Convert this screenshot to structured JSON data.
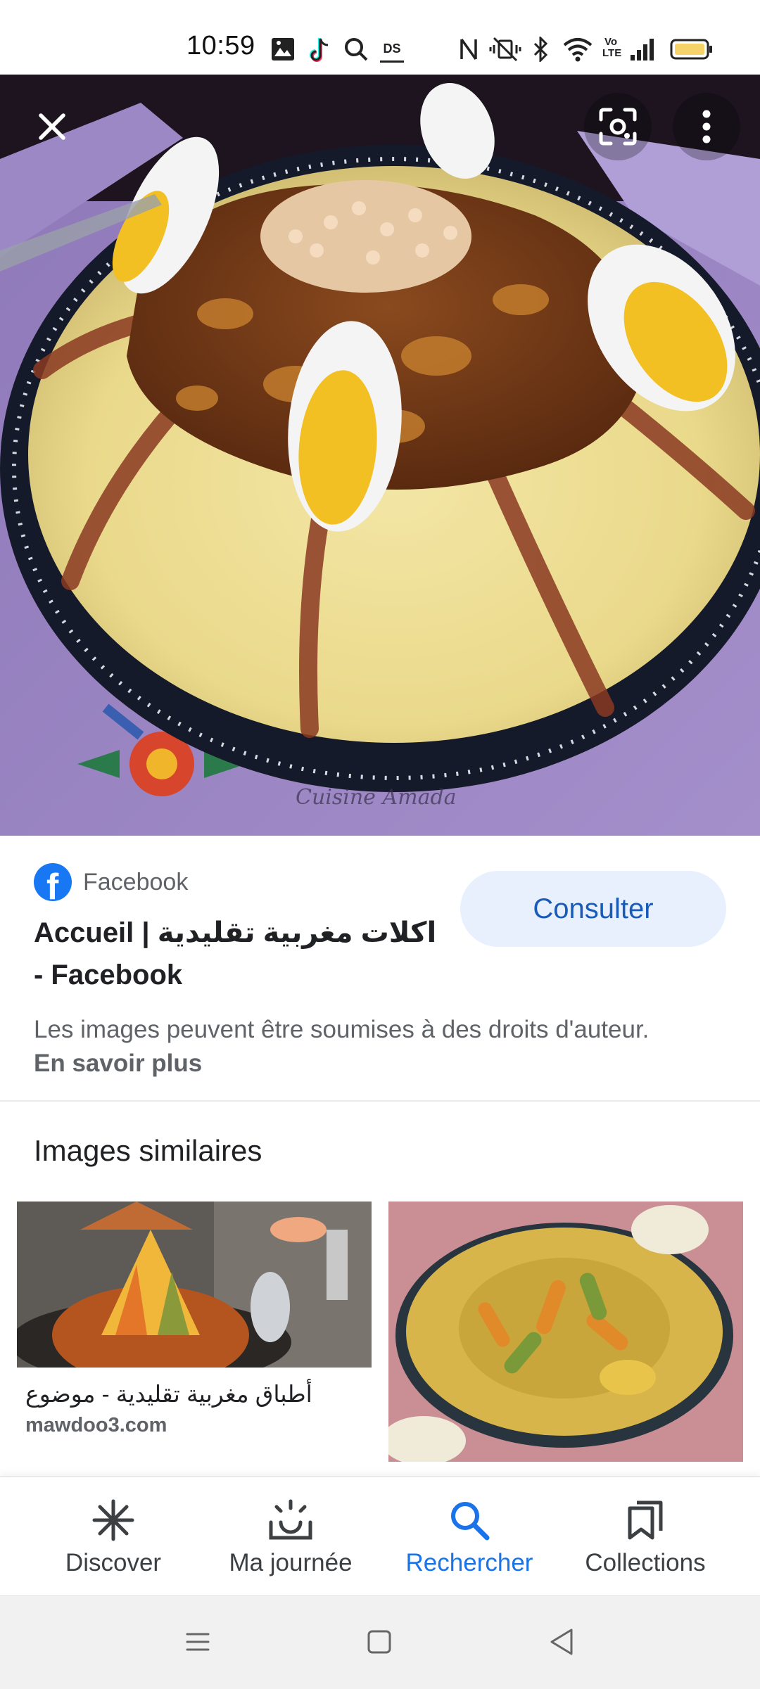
{
  "status_bar": {
    "time": "10:59",
    "icons": [
      "gallery-icon",
      "tiktok-icon",
      "search-icon",
      "ds-icon",
      "nfc-icon",
      "mute-vibrate-icon",
      "bluetooth-icon",
      "wifi-icon",
      "volte-icon",
      "signal-icon",
      "battery-icon"
    ],
    "ds_label": "DS",
    "volte_label": "Vo LTE"
  },
  "viewer": {
    "close_icon": "close-icon",
    "lens_icon": "lens-icon",
    "more_icon": "more-vert-icon",
    "watermark": "Cuisine Amada"
  },
  "result": {
    "source_name": "Facebook",
    "title": "Accueil | اكلات مغربية تقليدية - Facebook",
    "consult_label": "Consulter",
    "copyright_text": "Les images peuvent être soumises à des droits d'auteur.",
    "learn_more_label": "En savoir plus"
  },
  "similar": {
    "section_title": "Images similaires",
    "items": [
      {
        "caption": "أطباق مغربية تقليدية - موضوع",
        "domain": "mawdoo3.com"
      },
      {
        "caption": "",
        "domain": ""
      }
    ]
  },
  "bottom_nav": {
    "items": [
      {
        "label": "Discover",
        "icon": "asterisk-icon",
        "active": false
      },
      {
        "label": "Ma journée",
        "icon": "sunrise-icon",
        "active": false
      },
      {
        "label": "Rechercher",
        "icon": "search-icon",
        "active": true
      },
      {
        "label": "Collections",
        "icon": "bookmarks-icon",
        "active": false
      }
    ]
  },
  "system_nav": {
    "icons": [
      "menu-icon",
      "home-icon",
      "back-icon"
    ]
  },
  "colors": {
    "accent": "#1a73e8",
    "consult_bg": "#e8f0fe",
    "facebook_blue": "#1877f2"
  }
}
